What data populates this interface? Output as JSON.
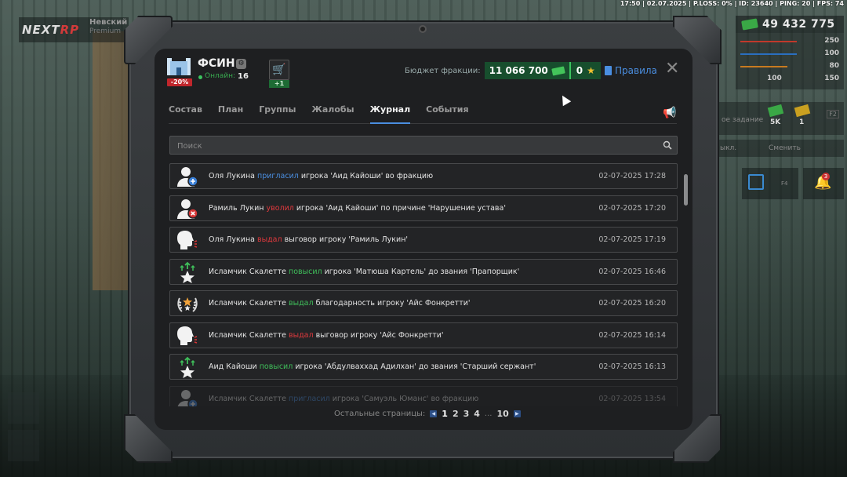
{
  "status_bar": "17:50 | 02.07.2025 | P.LOSS: 0% | ID: 23640 | PING: 20 | FPS: 74",
  "game_logo": {
    "text_a": "NEXT",
    "text_b": "RP"
  },
  "server": {
    "name": "Невский",
    "sub": "Premium"
  },
  "hud": {
    "money": "49 432 775",
    "stats": [
      "250",
      "100",
      "80",
      "100",
      "150"
    ],
    "task_label": "ое задание",
    "task_reward_cash": "5K",
    "task_reward_gold": "1",
    "task_key": "F2",
    "switch_left": "ыкл.",
    "switch_right": "Сменить",
    "calendar_key": "F4",
    "notifications_count": "3"
  },
  "header": {
    "faction_name": "ФСИН",
    "discount": "-20%",
    "online_label": "Онлайн:",
    "online_value": "16",
    "cart_badge": "+1",
    "budget_label": "Бюджет фракции:",
    "budget_value": "11 066 700",
    "stars_value": "0",
    "rules_label": "Правила",
    "close_label": "✕"
  },
  "tabs": [
    "Состав",
    "План",
    "Группы",
    "Жалобы",
    "Журнал",
    "События"
  ],
  "active_tab": "Журнал",
  "search": {
    "placeholder": "Поиск"
  },
  "log": [
    {
      "icon": "user-add-icon",
      "pre": "Оля Лукина ",
      "action": "пригласил",
      "action_color": "blue",
      "post": " игрока 'Аид Кайоши' во фракцию",
      "date": "02-07-2025 17:28"
    },
    {
      "icon": "user-remove-icon",
      "pre": "Рамиль Лукин ",
      "action": "уволил",
      "action_color": "red",
      "post": " игрока 'Аид Кайоши' по причине 'Нарушение устава'",
      "date": "02-07-2025 17:20"
    },
    {
      "icon": "reprimand-icon",
      "pre": "Оля Лукина ",
      "action": "выдал",
      "action_color": "red",
      "post": " выговор игроку 'Рамиль Лукин'",
      "date": "02-07-2025 17:19"
    },
    {
      "icon": "promote-icon",
      "pre": "Исламчик Скалетте ",
      "action": "повысил",
      "action_color": "green",
      "post": " игрока 'Матюша Картель' до звания 'Прапорщик'",
      "date": "02-07-2025 16:46"
    },
    {
      "icon": "laurel-icon",
      "pre": "Исламчик Скалетте ",
      "action": "выдал",
      "action_color": "green",
      "post": " благодарность игроку 'Айс Фонкретти'",
      "date": "02-07-2025 16:20"
    },
    {
      "icon": "reprimand-icon",
      "pre": "Исламчик Скалетте ",
      "action": "выдал",
      "action_color": "red",
      "post": " выговор игроку 'Айс Фонкретти'",
      "date": "02-07-2025 16:14"
    },
    {
      "icon": "promote-icon",
      "pre": "Аид Кайоши ",
      "action": "повысил",
      "action_color": "green",
      "post": " игрока 'Абдулвахxад Адилхан' до звания 'Старший сержант'",
      "date": "02-07-2025 16:13"
    },
    {
      "icon": "user-add-icon",
      "pre": "Исламчик Скалетте ",
      "action": "пригласил",
      "action_color": "blue",
      "post": " игрока 'Самуэль Юманс' во фракцию",
      "date": "02-07-2025 13:54"
    }
  ],
  "pagination": {
    "label": "Остальные страницы:",
    "pages": [
      "1",
      "2",
      "3",
      "4"
    ],
    "ellipsis": "...",
    "last": "10",
    "prev": "◀",
    "next": "▶"
  }
}
